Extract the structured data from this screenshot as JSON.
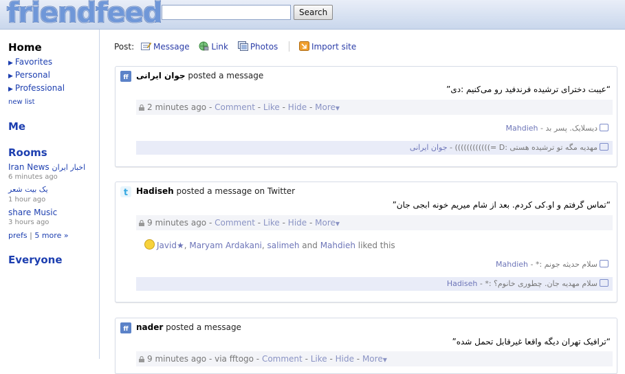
{
  "header": {
    "logo_text": "friendfeed",
    "search": {
      "value": "",
      "placeholder": ""
    },
    "search_button": "Search"
  },
  "sidebar": {
    "home": "Home",
    "nav": [
      {
        "label": "Favorites"
      },
      {
        "label": "Personal"
      },
      {
        "label": "Professional"
      }
    ],
    "new_list": "new list",
    "me": "Me",
    "rooms_title": "Rooms",
    "rooms": [
      {
        "name": "Iran News",
        "extra": "اخبار ایران",
        "time": "6 minutes ago"
      },
      {
        "name": "یک بیت شعر",
        "extra": "",
        "time": "1 hour ago"
      },
      {
        "name": "share Music",
        "extra": "",
        "time": "3 hours ago"
      }
    ],
    "prefs": "prefs",
    "prefs_sep": " | ",
    "more": "5 more »",
    "everyone": "Everyone"
  },
  "poster": {
    "label": "Post:",
    "message": "Message",
    "link": "Link",
    "photos": "Photos",
    "import_site": "Import site"
  },
  "entries": [
    {
      "author": "جوان ایرانی",
      "action": " posted a message",
      "body": "“عیبت دخترای ترشیده فرندفید رو می‌کنیم :دی”",
      "time": "2 minutes ago",
      "info_sep": " - ",
      "comment": "Comment",
      "like": "Like",
      "hide": "Hide",
      "more": "More",
      "comments": [
        {
          "text": "دیسلایک. پسر بد",
          "author": "Mahdieh",
          "sep": " - "
        },
        {
          "text": "مهدیه مگه تو ترشیده هستی :D =))))))))))))",
          "author": "جوان ایرانی",
          "sep": " - "
        }
      ]
    },
    {
      "author": "Hadiseh",
      "action": " posted a message on Twitter",
      "body": "“تماس گرفتم و او.کی کردم. بعد از شام میریم خونه ابجی جان”",
      "time": "9 minutes ago",
      "info_sep": " - ",
      "comment": "Comment",
      "like": "Like",
      "hide": "Hide",
      "more": "More",
      "likes": {
        "names": [
          "Javid★",
          "Maryam Ardakani",
          "salimeh"
        ],
        "and": " and ",
        "last": "Mahdieh",
        "suffix": " liked this"
      },
      "comments": [
        {
          "text": "سلام حدیثه جونم :*",
          "author": "Mahdieh",
          "sep": " - "
        },
        {
          "text": "سلام مهدیه جان. چطوری خانوم؟ :*",
          "author": "Hadiseh",
          "sep": " - "
        }
      ]
    },
    {
      "author": "nader",
      "action": " posted a message",
      "body": "“ترافیک تهران دیگه واقعا غیرقابل تحمل شده”",
      "time": "9 minutes ago",
      "via": " - via fftogo - ",
      "comment": "Comment",
      "like": "Like",
      "hide": "Hide",
      "more": "More"
    }
  ],
  "colors": {
    "link": "#2b3da8",
    "header_bg": "#c9d7ec",
    "logo": "#6f97d8",
    "comment_alt_bg": "#e9ecf8"
  }
}
